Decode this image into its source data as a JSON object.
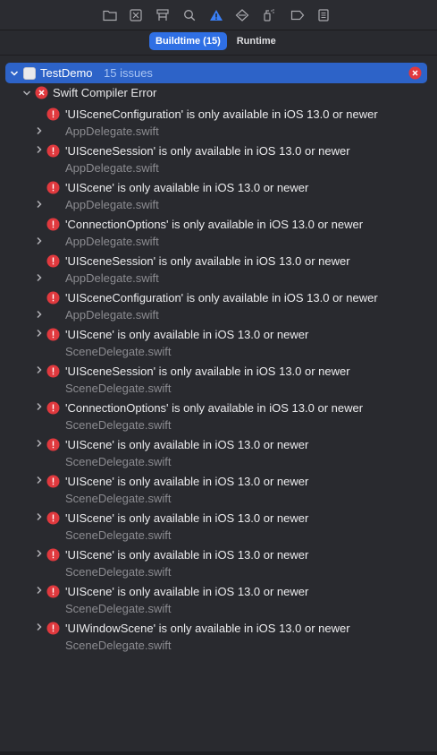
{
  "toolbar": {
    "icons": [
      "folder-icon",
      "source-control-icon",
      "symbol-hierarchy-icon",
      "find-icon",
      "issue-warning-icon",
      "test-diamond-icon",
      "debug-spray-icon",
      "breakpoint-icon",
      "report-list-icon"
    ],
    "active_icon": "issue-warning-icon",
    "accent_color": "#3a7ff6"
  },
  "segments": {
    "buildtime_label": "Buildtime (15)",
    "runtime_label": "Runtime",
    "selected": "Buildtime (15)"
  },
  "project": {
    "name": "TestDemo",
    "issue_count": "15 issues"
  },
  "group": {
    "label": "Swift Compiler Error"
  },
  "issues": [
    {
      "message": "'UISceneConfiguration' is only available in iOS 13.0 or newer",
      "file": "AppDelegate.swift"
    },
    {
      "message": "'UISceneSession' is only available in iOS 13.0 or newer",
      "file": "AppDelegate.swift"
    },
    {
      "message": "'UIScene' is only available in iOS 13.0 or newer",
      "file": "AppDelegate.swift"
    },
    {
      "message": "'ConnectionOptions' is only available in iOS 13.0 or newer",
      "file": "AppDelegate.swift"
    },
    {
      "message": "'UISceneSession' is only available in iOS 13.0 or newer",
      "file": "AppDelegate.swift"
    },
    {
      "message": "'UISceneConfiguration' is only available in iOS 13.0 or newer",
      "file": "AppDelegate.swift"
    },
    {
      "message": "'UIScene' is only available in iOS 13.0 or newer",
      "file": "SceneDelegate.swift"
    },
    {
      "message": "'UISceneSession' is only available in iOS 13.0 or newer",
      "file": "SceneDelegate.swift"
    },
    {
      "message": "'ConnectionOptions' is only available in iOS 13.0 or newer",
      "file": "SceneDelegate.swift"
    },
    {
      "message": "'UIScene' is only available in iOS 13.0 or newer",
      "file": "SceneDelegate.swift"
    },
    {
      "message": "'UIScene' is only available in iOS 13.0 or newer",
      "file": "SceneDelegate.swift"
    },
    {
      "message": "'UIScene' is only available in iOS 13.0 or newer",
      "file": "SceneDelegate.swift"
    },
    {
      "message": "'UIScene' is only available in iOS 13.0 or newer",
      "file": "SceneDelegate.swift"
    },
    {
      "message": "'UIScene' is only available in iOS 13.0 or newer",
      "file": "SceneDelegate.swift"
    },
    {
      "message": "'UIWindowScene' is only available in iOS 13.0 or newer",
      "file": "SceneDelegate.swift"
    }
  ],
  "colors": {
    "error_red": "#e0393e",
    "selection_blue": "#2d63c8",
    "segment_blue": "#2f6fe4"
  }
}
